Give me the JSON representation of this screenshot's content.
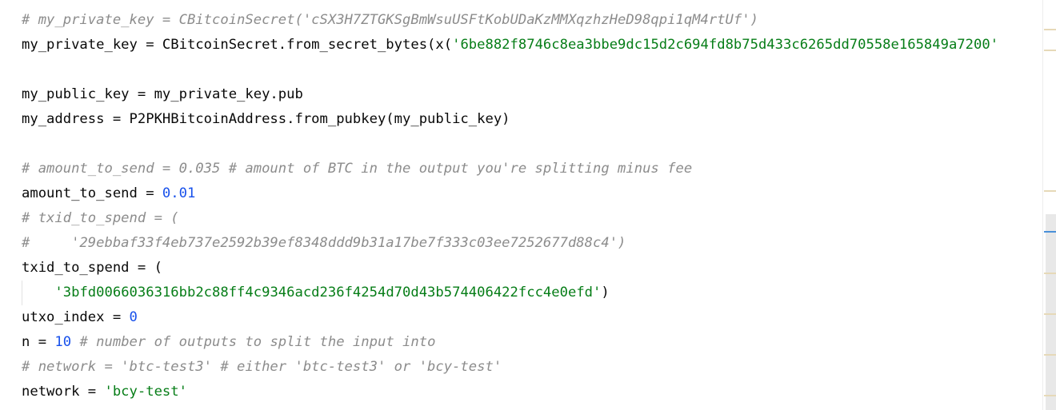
{
  "editor": {
    "lines": [
      {
        "segments": [
          {
            "kind": "comment",
            "text": "# my_private_key = CBitcoinSecret('cSX3H7ZTGKSgBmWsuUSFtKobUDaKzMMXqzhzHeD98qpi1qM4rtUf')"
          }
        ]
      },
      {
        "segments": [
          {
            "kind": "plain",
            "text": "my_private_key = CBitcoinSecret.from_secret_bytes(x("
          },
          {
            "kind": "string",
            "text": "'6be882f8746c8ea3bbe9dc15d2c694fd8b75d433c6265dd70558e165849a7200'"
          }
        ]
      },
      {
        "segments": []
      },
      {
        "segments": [
          {
            "kind": "plain",
            "text": "my_public_key = my_private_key.pub"
          }
        ]
      },
      {
        "segments": [
          {
            "kind": "plain",
            "text": "my_address = P2PKHBitcoinAddress.from_pubkey(my_public_key)"
          }
        ]
      },
      {
        "segments": []
      },
      {
        "segments": [
          {
            "kind": "comment",
            "text": "# amount_to_send = 0.035 # amount of BTC in the output you're splitting minus fee"
          }
        ]
      },
      {
        "segments": [
          {
            "kind": "plain",
            "text": "amount_to_send = "
          },
          {
            "kind": "number",
            "text": "0.01"
          }
        ]
      },
      {
        "segments": [
          {
            "kind": "comment",
            "text": "# txid_to_spend = ("
          }
        ]
      },
      {
        "segments": [
          {
            "kind": "comment",
            "text": "#     '29ebbaf33f4eb737e2592b39ef8348ddd9b31a17be7f333c03ee7252677d88c4')"
          }
        ]
      },
      {
        "segments": [
          {
            "kind": "plain",
            "text": "txid_to_spend = ("
          }
        ]
      },
      {
        "segments": [
          {
            "kind": "plain",
            "text": "    "
          },
          {
            "kind": "string",
            "text": "'3bfd0066036316bb2c88ff4c9346acd236f4254d70d43b574406422fcc4e0efd'"
          },
          {
            "kind": "plain",
            "text": ")"
          }
        ]
      },
      {
        "segments": [
          {
            "kind": "plain",
            "text": "utxo_index = "
          },
          {
            "kind": "number",
            "text": "0"
          }
        ]
      },
      {
        "segments": [
          {
            "kind": "plain",
            "text": "n = "
          },
          {
            "kind": "number",
            "text": "10"
          },
          {
            "kind": "comment",
            "text": " # number of outputs to split the input into"
          }
        ]
      },
      {
        "segments": [
          {
            "kind": "comment",
            "text": "# network = 'btc-test3' # either 'btc-test3' or 'bcy-test'"
          }
        ]
      },
      {
        "segments": [
          {
            "kind": "plain",
            "text": "network = "
          },
          {
            "kind": "string",
            "text": "'bcy-test'"
          }
        ]
      }
    ]
  },
  "colors": {
    "comment": "#8c8c8c",
    "string": "#067d17",
    "number": "#1750eb",
    "plain": "#080808",
    "scroll_marker_warning": "#e6d9b8",
    "scroll_marker_caret": "#4a90d9"
  }
}
